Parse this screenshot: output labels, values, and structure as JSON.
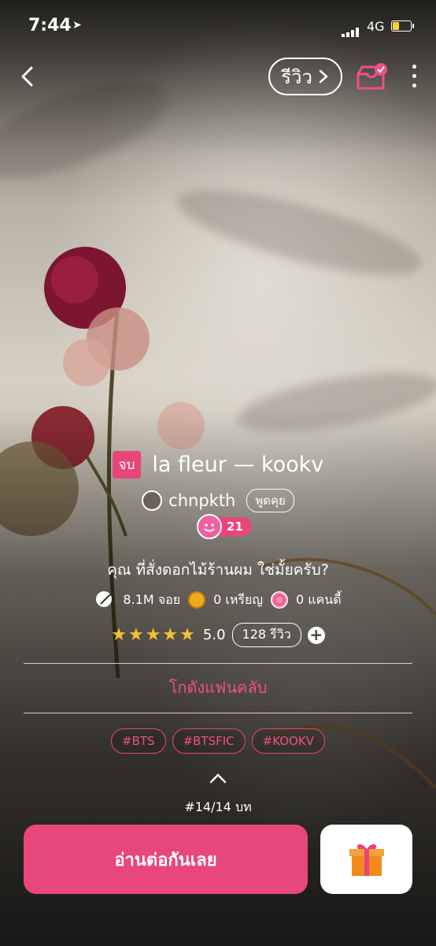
{
  "status_bar": {
    "time": "7:44",
    "network": "4G"
  },
  "header": {
    "review_label": "รีวิว"
  },
  "story": {
    "status_badge": "จบ",
    "title": "la fleur — kookv",
    "author": "chnpkth",
    "chat_label": "พูดคุย",
    "level": "21",
    "description": "คุณ ที่สั่งดอกไม้ร้านผม ใช่มั้ยครับ?",
    "stats": {
      "reads": "8.1M จอย",
      "coins": "0 เหรียญ",
      "candies": "0 แคนดี้"
    },
    "rating": "5.0",
    "rating_stars": 5,
    "review_count_label": "128 รีวิว",
    "fan_club_label": "โกดังแฟนคลับ",
    "tags": [
      "#BTS",
      "#BTSFIC",
      "#KOOKV"
    ],
    "chapter_label": "#14/14 บท"
  },
  "actions": {
    "read_label": "อ่านต่อกันเลย"
  },
  "colors": {
    "accent": "#e8477c",
    "star": "#f3c232"
  }
}
